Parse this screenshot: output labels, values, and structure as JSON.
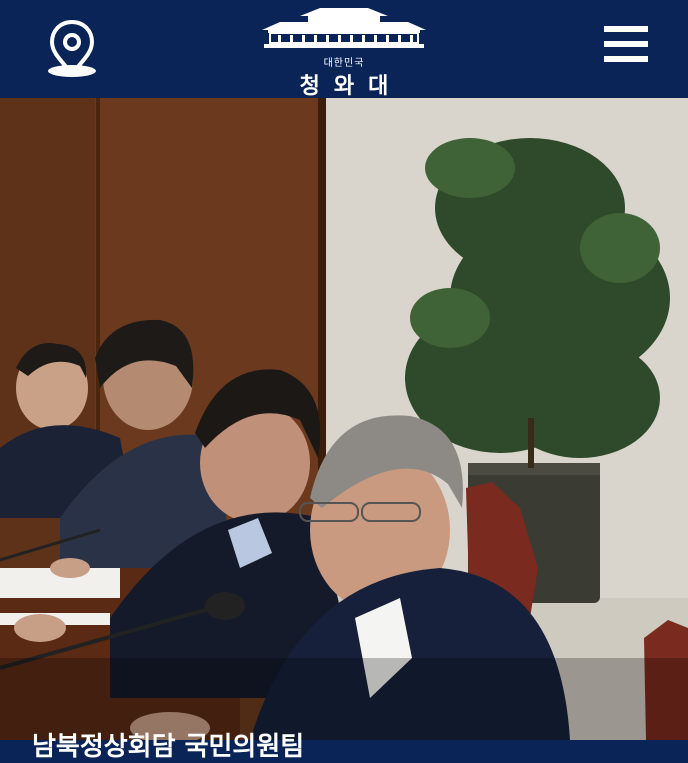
{
  "header": {
    "logo_subtitle": "대한민국",
    "logo_title": "청와대"
  },
  "hero": {
    "caption": "남북정상회담 국민의원팀"
  },
  "colors": {
    "header_bg": "#0b2457",
    "icon": "#ffffff"
  },
  "icons": [
    "location-pin-icon",
    "menu-icon"
  ]
}
